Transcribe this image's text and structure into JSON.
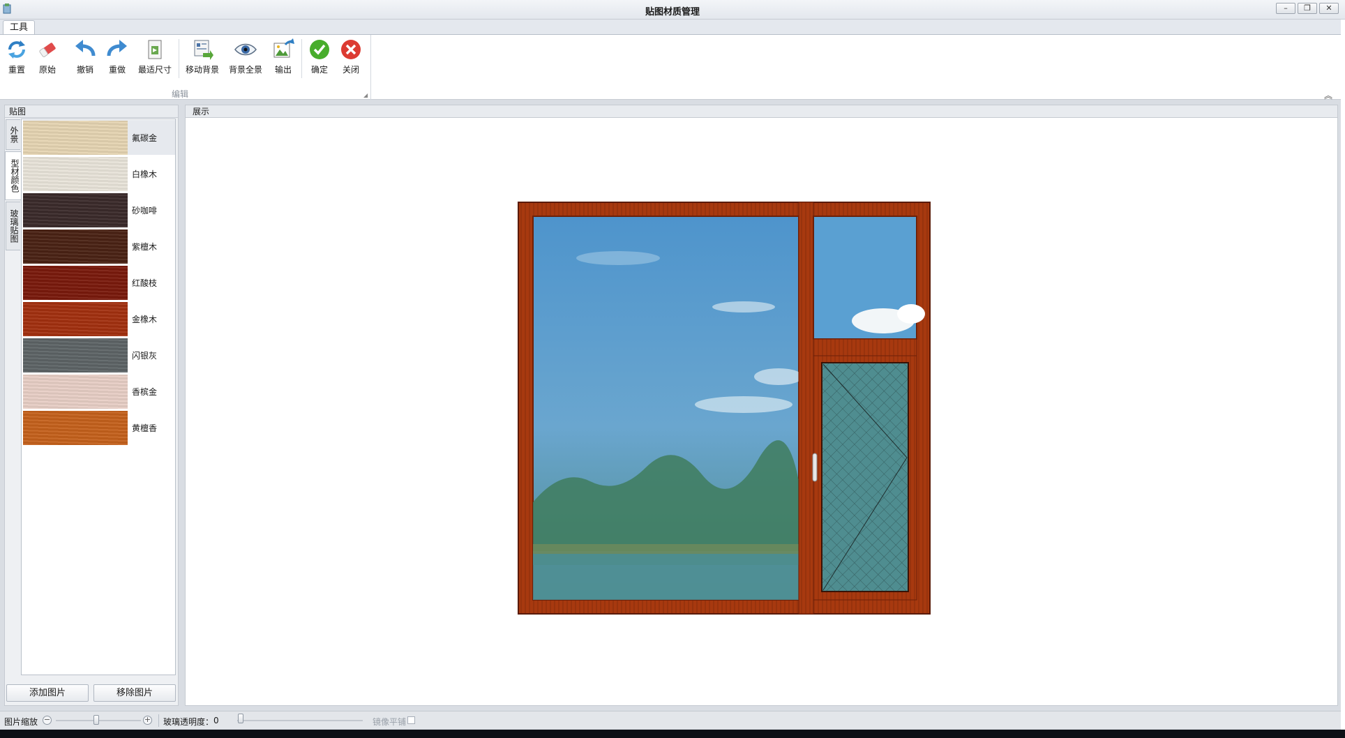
{
  "window": {
    "title": "贴图材质管理",
    "min": "–",
    "restore": "❐",
    "close": "✕"
  },
  "ribbon": {
    "tab": "工具",
    "group_label": "编辑",
    "buttons": [
      {
        "label": "重置",
        "icon": "refresh-icon"
      },
      {
        "label": "原始",
        "icon": "eraser-icon"
      },
      {
        "label": "撤销",
        "icon": "undo-icon"
      },
      {
        "label": "重做",
        "icon": "redo-icon"
      },
      {
        "label": "最适尺寸",
        "icon": "fit-size-icon"
      },
      {
        "label": "移动背景",
        "icon": "move-background-icon"
      },
      {
        "label": "背景全景",
        "icon": "eye-icon"
      },
      {
        "label": "输出",
        "icon": "export-image-icon"
      },
      {
        "label": "确定",
        "icon": "check-icon"
      },
      {
        "label": "关闭",
        "icon": "close-circle-icon"
      }
    ]
  },
  "left_panel": {
    "title": "贴图",
    "tabs": [
      "外景",
      "型材颜色",
      "玻璃贴图"
    ],
    "active_tab": "型材颜色",
    "textures": [
      {
        "name": "氟碳金",
        "color": "#e6d5b3"
      },
      {
        "name": "白橡木",
        "color": "#e9e4da"
      },
      {
        "name": "砂咖啡",
        "color": "#3a2a2a"
      },
      {
        "name": "紫檀木",
        "color": "#4a2214"
      },
      {
        "name": "红酸枝",
        "color": "#7a1a0c"
      },
      {
        "name": "金橡木",
        "color": "#a3300f"
      },
      {
        "name": "闪银灰",
        "color": "#5d6466"
      },
      {
        "name": "香槟金",
        "color": "#e8cfc6"
      },
      {
        "name": "黄檀香",
        "color": "#c5611c"
      }
    ],
    "add_button": "添加图片",
    "remove_button": "移除图片"
  },
  "main_panel": {
    "title": "展示"
  },
  "status": {
    "zoom_label": "图片缩放",
    "glass_label": "玻璃透明度：",
    "glass_value": "0",
    "mirror_label": "镜像平铺"
  },
  "colors": {
    "frame": "#a7390f",
    "frame_dark": "#6e2008",
    "glass": "#5f9ecf"
  }
}
